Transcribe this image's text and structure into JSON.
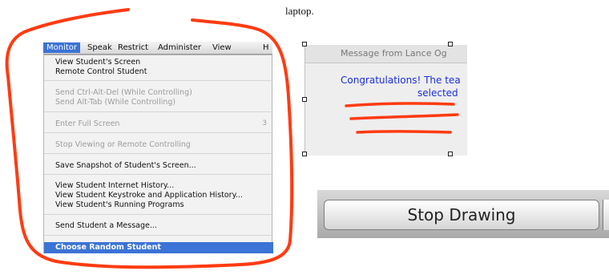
{
  "doc_text": "laptop.",
  "menubar": {
    "items": [
      "Monitor",
      "Speak",
      "Restrict",
      "Administer",
      "View",
      "H"
    ]
  },
  "menu": {
    "items": [
      {
        "label": "View Student's Screen",
        "disabled": false
      },
      {
        "label": "Remote Control Student",
        "disabled": false
      },
      {
        "label": "Send Ctrl-Alt-Del (While Controlling)",
        "disabled": true
      },
      {
        "label": "Send Alt-Tab (While Controlling)",
        "disabled": true
      },
      {
        "label": "Enter Full Screen",
        "disabled": true,
        "shortcut": "3"
      },
      {
        "label": "Stop Viewing or Remote Controlling",
        "disabled": true
      },
      {
        "label": "Save Snapshot of Student's Screen...",
        "disabled": false
      },
      {
        "label": "View Student Internet History...",
        "disabled": false
      },
      {
        "label": "View Student Keystroke and Application History...",
        "disabled": false
      },
      {
        "label": "View Student's Running Programs",
        "disabled": false
      },
      {
        "label": "Send Student a Message...",
        "disabled": false
      },
      {
        "label": "Choose Random Student",
        "highlighted": true
      }
    ]
  },
  "dialog": {
    "title": "Message from Lance Og",
    "message_line1": "Congratulations! The tea",
    "message_line2": "selected"
  },
  "stop_button": {
    "label": "Stop Drawing"
  },
  "colors": {
    "annotation": "#ff3b12",
    "menu_highlight": "#3b73d6",
    "message_text": "#1a2ee0"
  }
}
